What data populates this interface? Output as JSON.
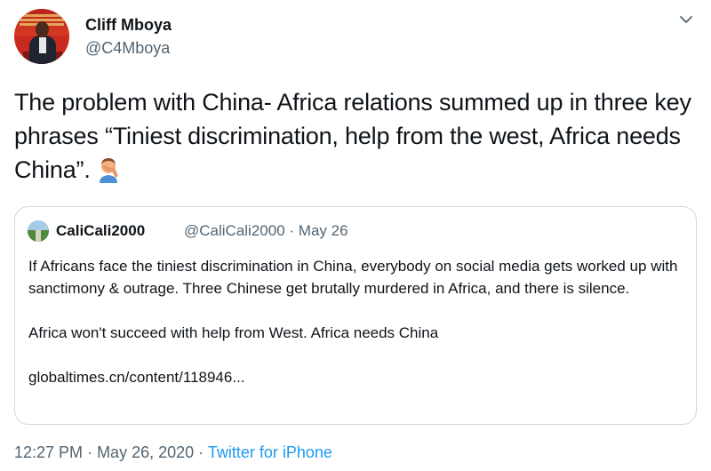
{
  "author": {
    "display_name": "Cliff Mboya",
    "handle": "@C4Mboya"
  },
  "tweet": {
    "text": "The problem with China- Africa relations summed up in three key phrases “Tiniest discrimination, help from the west, Africa needs China”.",
    "emoji": "man-facepalming"
  },
  "quoted": {
    "display_name": "CaliCali2000",
    "handle": "@CaliCali2000",
    "date": "May 26",
    "paragraph1": "If Africans face the tiniest discrimination in China, everybody on social media gets worked up with sanctimony & outrage. Three Chinese get brutally murdered in Africa, and there is silence.",
    "paragraph2": "Africa won't succeed with help from West. Africa needs China",
    "link": "globaltimes.cn/content/118946..."
  },
  "footer": {
    "time": "12:27 PM",
    "date": "May 26, 2020",
    "source": "Twitter for iPhone"
  },
  "colors": {
    "text": "#0f1419",
    "secondary": "#536471",
    "link": "#1d9bf0",
    "border": "#cfd9de"
  }
}
